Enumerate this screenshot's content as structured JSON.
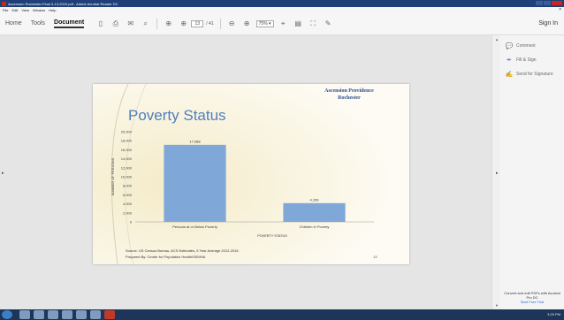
{
  "window": {
    "title": "Ascension Rochester-Final 3-13-2019.pdf - Adobe Acrobat Reader DC"
  },
  "menu": {
    "items": [
      "File",
      "Edit",
      "View",
      "Window",
      "Help"
    ],
    "close": "×"
  },
  "toolbar": {
    "home": "Home",
    "tools": "Tools",
    "document": "Document",
    "page_current": "13",
    "page_total": "/ 41",
    "zoom": "75%",
    "sign_in": "Sign In"
  },
  "right_pane": {
    "comment": "Comment",
    "fill_sign": "Fill & Sign",
    "send_signature": "Send for Signature",
    "promo_text": "Convert and edit PDFs with Acrobat Pro DC",
    "promo_link": "Start Free Trial"
  },
  "slide": {
    "org_line1": "Ascension Providence",
    "org_line2": "Rochester",
    "title": "Poverty Status",
    "source": "Source: US Census Bureau, ACS Estimates, 5 Year Average 2012-2016",
    "prepared": "Prepared By: Center for Population Health/SEMHA",
    "page_number": "13"
  },
  "chart_data": {
    "type": "bar",
    "categories": [
      "Persons at or Below Poverty",
      "Children in Poverty"
    ],
    "values": [
      17088,
      4159
    ],
    "data_labels": [
      "17,088",
      "4,159"
    ],
    "xlabel": "POVERTY STATUS",
    "ylabel": "NUMBER OF PERSONS",
    "ylim": [
      0,
      20000
    ],
    "yticks": [
      "0",
      "2,000",
      "4,000",
      "6,000",
      "8,000",
      "10,000",
      "12,000",
      "14,000",
      "16,000",
      "18,000",
      "20,000"
    ],
    "grid": false,
    "legend": "none",
    "bar_color": "#7fa8d8"
  },
  "taskbar": {
    "time": "3:25 PM"
  }
}
